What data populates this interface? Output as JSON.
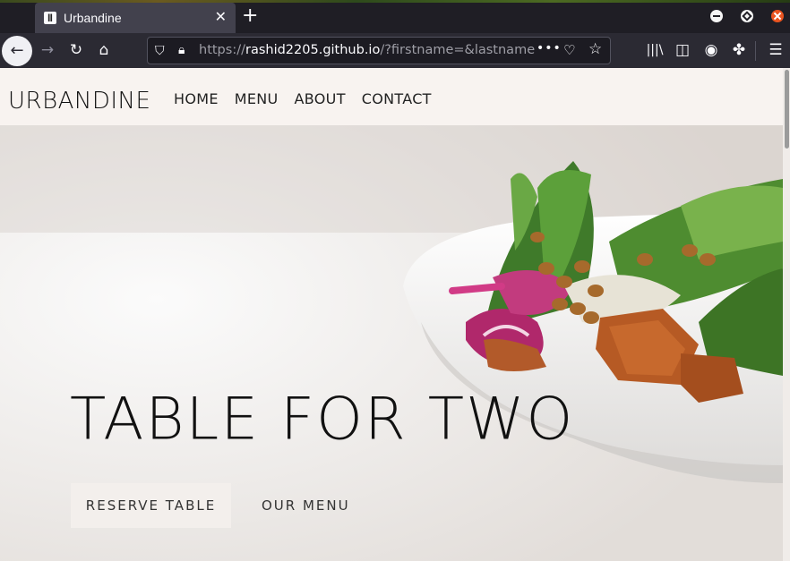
{
  "browser": {
    "tab": {
      "title": "Urbandine",
      "favicon": "fork-knife-icon"
    },
    "url": {
      "host": "rashid2205.github.io",
      "prefix": "https://",
      "rest": "/?firstname=&lastname=&"
    }
  },
  "site": {
    "brand": "URBANDINE",
    "nav": [
      "HOME",
      "MENU",
      "ABOUT",
      "CONTACT"
    ],
    "hero": {
      "title": "TABLE FOR TWO",
      "primary_cta": "RESERVE TABLE",
      "secondary_cta": "OUR MENU"
    }
  },
  "colors": {
    "accent_close": "#e95420",
    "page_bg": "#f8f3f0",
    "toolbar_bg": "#2b2a33"
  }
}
